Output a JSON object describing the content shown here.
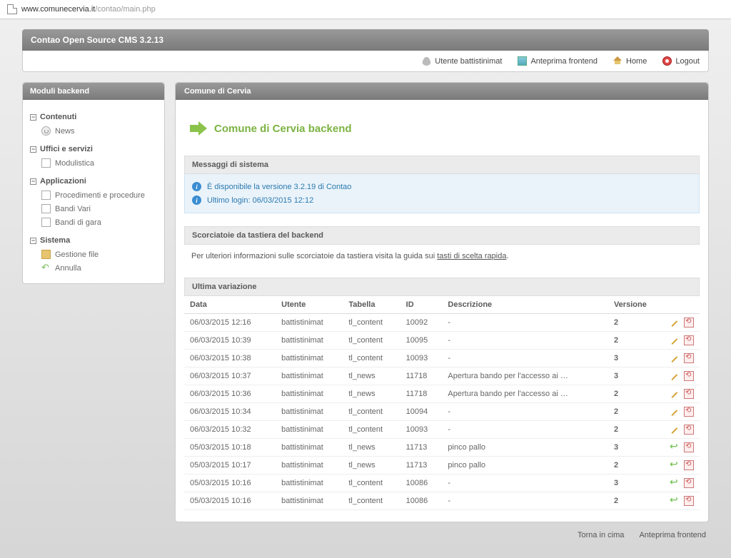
{
  "browser": {
    "url_host": "www.comunecervia.it",
    "url_path": "/contao/main.php"
  },
  "titlebar": "Contao Open Source CMS 3.2.13",
  "topnav": {
    "user_prefix": "Utente",
    "user_name": "battistinimat",
    "preview": "Anteprima frontend",
    "home": "Home",
    "logout": "Logout"
  },
  "sidebar": {
    "title": "Moduli backend",
    "groups": [
      {
        "label": "Contenuti",
        "items": [
          {
            "label": "News",
            "icon": "news"
          }
        ]
      },
      {
        "label": "Uffici e servizi",
        "items": [
          {
            "label": "Modulistica",
            "icon": "page"
          }
        ]
      },
      {
        "label": "Applicazioni",
        "items": [
          {
            "label": "Procedimenti e procedure",
            "icon": "page"
          },
          {
            "label": "Bandi Vari",
            "icon": "page"
          },
          {
            "label": "Bandi di gara",
            "icon": "page"
          }
        ]
      },
      {
        "label": "Sistema",
        "items": [
          {
            "label": "Gestione file",
            "icon": "folder"
          },
          {
            "label": "Annulla",
            "icon": "back"
          }
        ]
      }
    ]
  },
  "main": {
    "title": "Comune di Cervia",
    "headline": "Comune di Cervia backend",
    "messages_title": "Messaggi di sistema",
    "messages": [
      "È disponibile la versione 3.2.19 di Contao",
      "Ultimo login: 06/03/2015 12:12"
    ],
    "shortcuts_title": "Scorciatoie da tastiera del backend",
    "shortcuts_text": "Per ulteriori informazioni sulle scorciatoie da tastiera visita la guida sui ",
    "shortcuts_link": "tasti di scelta rapida",
    "lastchange_title": "Ultima variazione",
    "columns": {
      "date": "Data",
      "user": "Utente",
      "table": "Tabella",
      "id": "ID",
      "desc": "Descrizione",
      "version": "Versione"
    },
    "rows": [
      {
        "date": "06/03/2015 12:16",
        "user": "battistinimat",
        "table": "tl_content",
        "id": "10092",
        "desc": "-",
        "version": "2",
        "act": "edit"
      },
      {
        "date": "06/03/2015 10:39",
        "user": "battistinimat",
        "table": "tl_content",
        "id": "10095",
        "desc": "-",
        "version": "2",
        "act": "edit"
      },
      {
        "date": "06/03/2015 10:38",
        "user": "battistinimat",
        "table": "tl_content",
        "id": "10093",
        "desc": "-",
        "version": "3",
        "act": "edit"
      },
      {
        "date": "06/03/2015 10:37",
        "user": "battistinimat",
        "table": "tl_news",
        "id": "11718",
        "desc": "Apertura bando per l'accesso ai …",
        "version": "3",
        "act": "edit"
      },
      {
        "date": "06/03/2015 10:36",
        "user": "battistinimat",
        "table": "tl_news",
        "id": "11718",
        "desc": "Apertura bando per l'accesso ai …",
        "version": "2",
        "act": "edit"
      },
      {
        "date": "06/03/2015 10:34",
        "user": "battistinimat",
        "table": "tl_content",
        "id": "10094",
        "desc": "-",
        "version": "2",
        "act": "edit"
      },
      {
        "date": "06/03/2015 10:32",
        "user": "battistinimat",
        "table": "tl_content",
        "id": "10093",
        "desc": "-",
        "version": "2",
        "act": "edit"
      },
      {
        "date": "05/03/2015 10:18",
        "user": "battistinimat",
        "table": "tl_news",
        "id": "11713",
        "desc": "pinco pallo",
        "version": "3",
        "act": "undo"
      },
      {
        "date": "05/03/2015 10:17",
        "user": "battistinimat",
        "table": "tl_news",
        "id": "11713",
        "desc": "pinco pallo",
        "version": "2",
        "act": "undo"
      },
      {
        "date": "05/03/2015 10:16",
        "user": "battistinimat",
        "table": "tl_content",
        "id": "10086",
        "desc": "-",
        "version": "3",
        "act": "undo"
      },
      {
        "date": "05/03/2015 10:16",
        "user": "battistinimat",
        "table": "tl_content",
        "id": "10086",
        "desc": "-",
        "version": "2",
        "act": "undo"
      }
    ]
  },
  "footer": {
    "top": "Torna in cima",
    "preview": "Anteprima frontend"
  }
}
